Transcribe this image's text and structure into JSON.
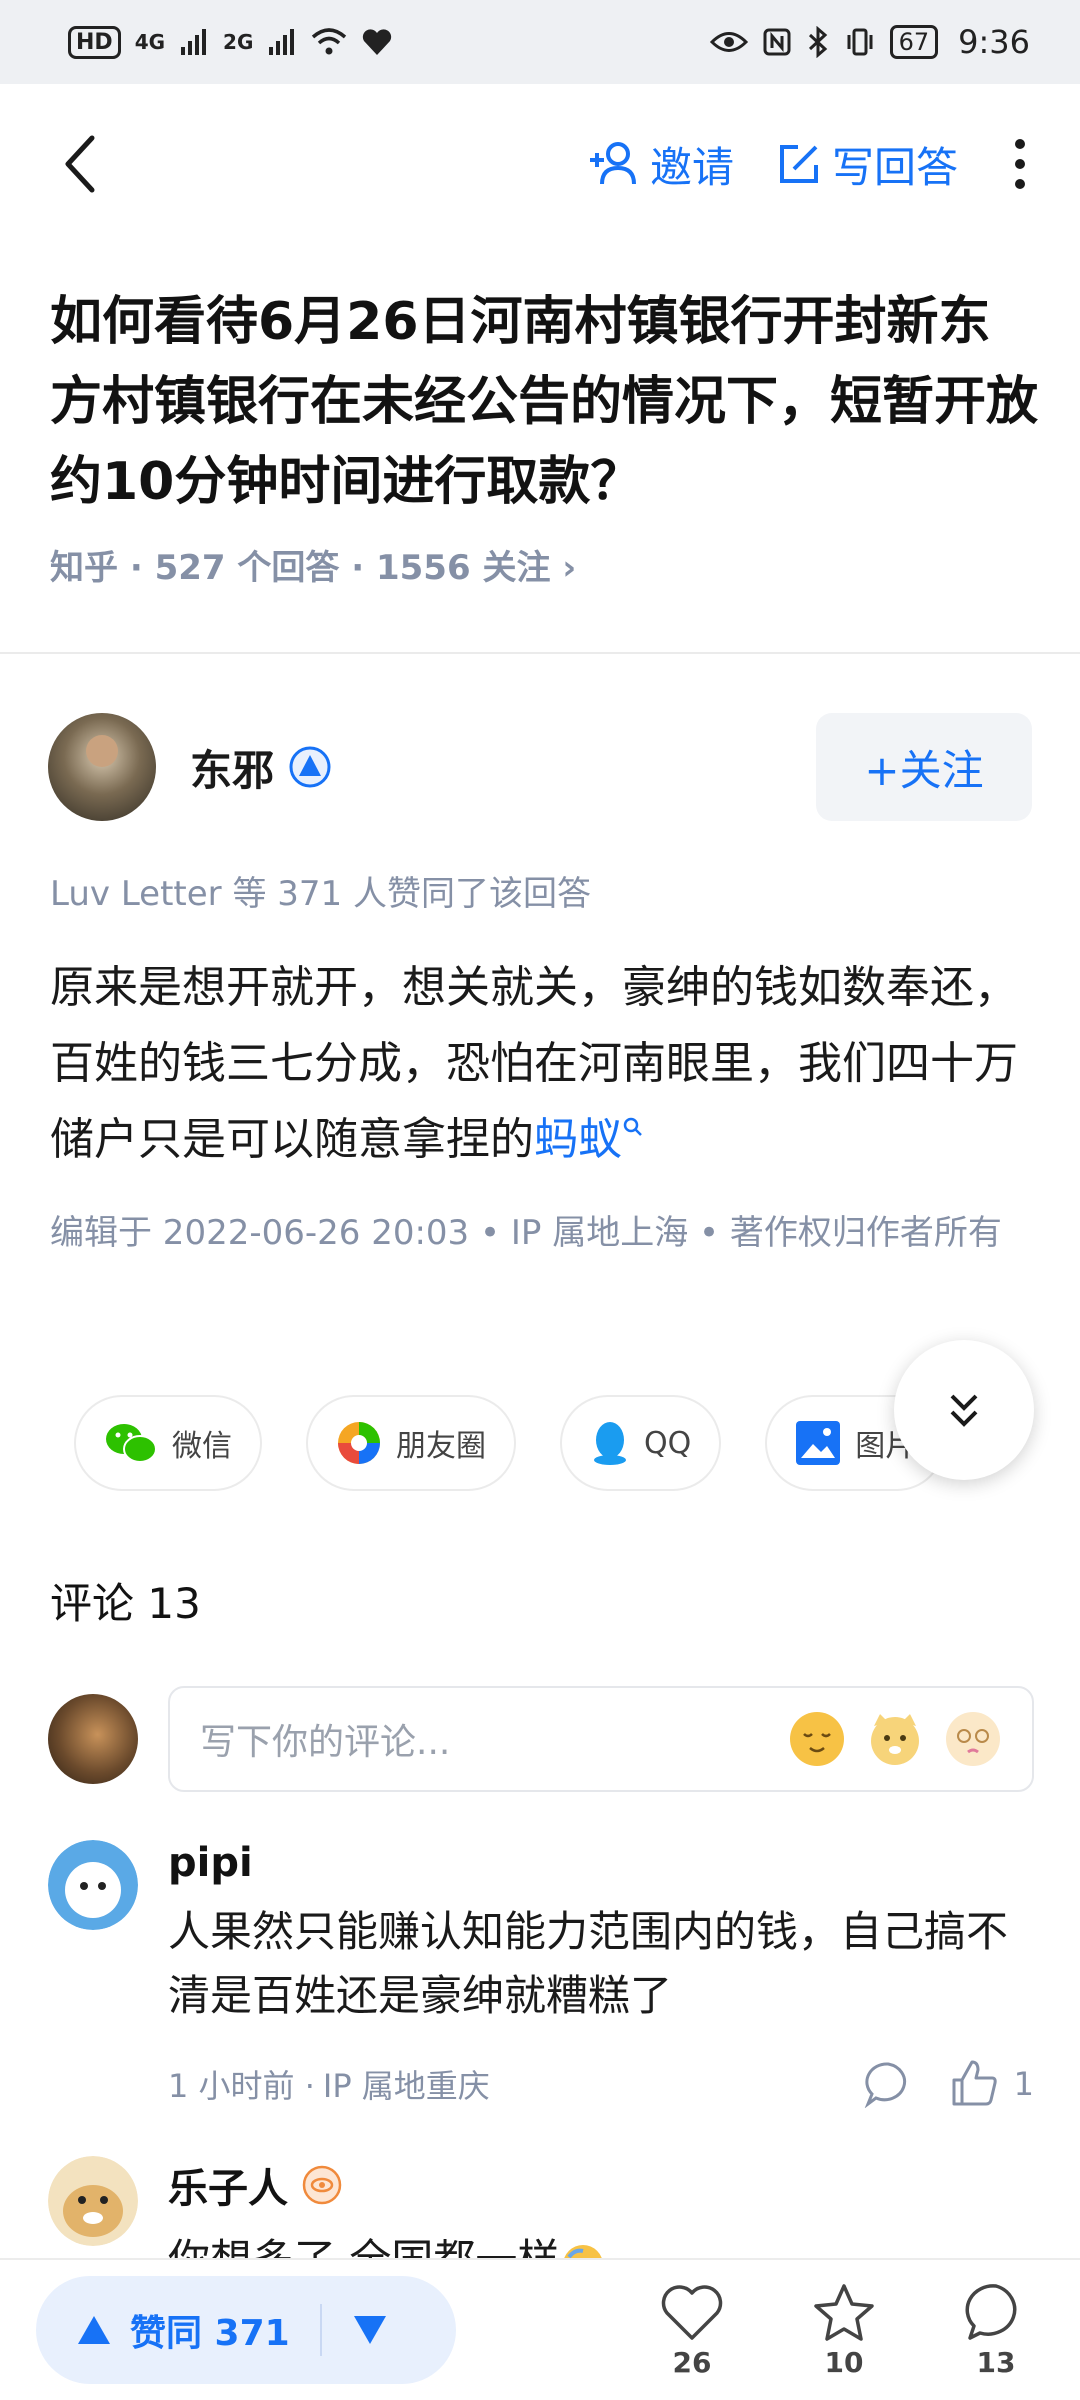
{
  "status_bar": {
    "left_badge": "HD",
    "net1": "4G",
    "net2": "2G",
    "battery": "67",
    "time": "9:36"
  },
  "top_bar": {
    "invite_label": "邀请",
    "write_answer_label": "写回答"
  },
  "question": {
    "title": "如何看待6月26日河南村镇银行开封新东方村镇银行在未经公告的情况下，短暂开放约10分钟时间进行取款？",
    "meta": "知乎 · 527 个回答 · 1556 关注 ›"
  },
  "answer": {
    "author_name": "东邪",
    "follow_label": "+关注",
    "agree_line": "Luv Letter 等 371 人赞同了该回答",
    "content": "原来是想开就开，想关就关，豪绅的钱如数奉还，百姓的钱三七分成，恐怕在河南眼里，我们四十万储户只是可以随意拿捏的",
    "content_link": "蚂蚁",
    "edit_meta": "编辑于 2022-06-26 20:03 • IP 属地上海 • 著作权归作者所有"
  },
  "share": {
    "wechat": "微信",
    "moments": "朋友圈",
    "qq": "QQ",
    "image": "图片"
  },
  "comments": {
    "title": "评论 13",
    "placeholder": "写下你的评论...",
    "items": [
      {
        "name": "pipi",
        "text": "人果然只能赚认知能力范围内的钱，自己搞不清是百姓还是豪绅就糟糕了",
        "time": "1 小时前 · ",
        "location": "IP 属地重庆",
        "likes": "1"
      },
      {
        "name": "乐子人",
        "text": "你想多了 全国都一样"
      }
    ]
  },
  "bottom_bar": {
    "vote_label": "赞同 371",
    "favorites": "26",
    "collect": "10",
    "comment_count": "13"
  },
  "colors": {
    "accent": "#1772f6",
    "meta_gray": "#8590a6"
  }
}
